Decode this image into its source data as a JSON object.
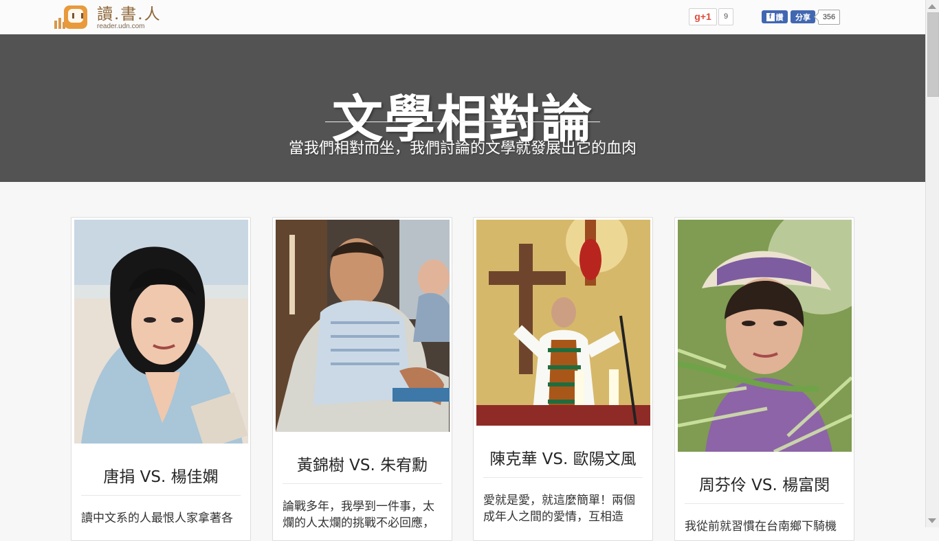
{
  "site": {
    "logo_title": "讀.書.人",
    "logo_subtitle": "reader.udn.com"
  },
  "social": {
    "gplus_label": "g+1",
    "gplus_count": "9",
    "fb_like_label": "讚",
    "fb_share_label": "分享",
    "fb_count": "356"
  },
  "hero": {
    "title": "文學相對論",
    "subtitle": "當我們相對而坐，我們討論的文學就發展出它的血肉"
  },
  "cards": [
    {
      "title": "唐捐 VS. 楊佳嫻",
      "excerpt": "讀中文系的人最恨人家拿著各"
    },
    {
      "title": "黃錦樹 VS. 朱宥勳",
      "excerpt": "論戰多年，我學到一件事，太\n爛的人太爛的挑戰不必回應，"
    },
    {
      "title": "陳克華 VS. 歐陽文風",
      "excerpt": "愛就是愛，就這麼簡單！兩個\n成年人之間的愛情，互相造"
    },
    {
      "title": "周芬伶 VS. 楊富閔",
      "excerpt": "我從前就習慣在台南鄉下騎機"
    }
  ]
}
